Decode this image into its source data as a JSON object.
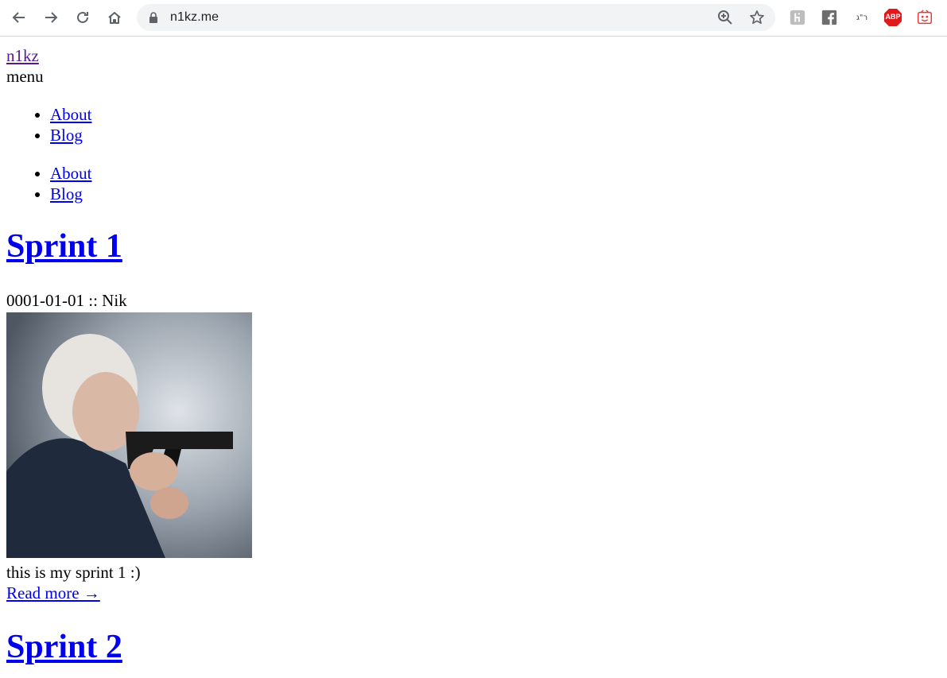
{
  "browser": {
    "url": "n1kz.me",
    "extensions": [
      {
        "icon": "hola-extension-icon"
      },
      {
        "icon": "facebook-extension-icon"
      },
      {
        "icon": "hebrew-text-extension-icon",
        "label": "ר\"ג"
      },
      {
        "icon": "adblock-plus-icon",
        "label": "ABP"
      },
      {
        "icon": "red-extension-icon"
      }
    ]
  },
  "site": {
    "logo": "n1kz",
    "menu_label": "menu",
    "menu_items": [
      {
        "label": "About"
      },
      {
        "label": "Blog"
      }
    ]
  },
  "posts": [
    {
      "title": "Sprint 1",
      "meta": "0001-01-01 :: Nik",
      "excerpt": "this is my sprint 1 :)",
      "read_more": "Read more →"
    },
    {
      "title": "Sprint 2"
    }
  ],
  "colors": {
    "link": "#0000ee",
    "visited_link": "#551a8b",
    "omnibox_bg": "#f1f3f4",
    "abp_red": "#e0191c"
  }
}
